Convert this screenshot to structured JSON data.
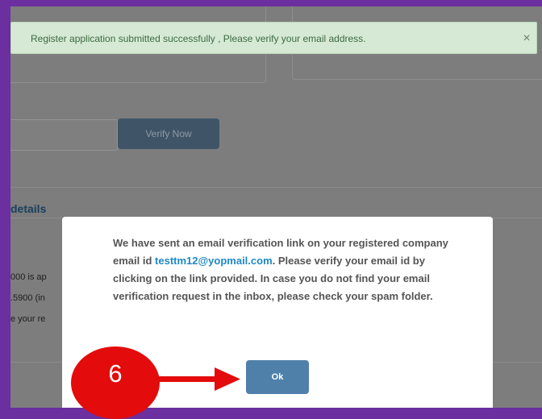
{
  "alert": {
    "message": "Register application submitted successfully , Please verify your email address.",
    "close_symbol": "×"
  },
  "background": {
    "verify_button_label": "Verify Now",
    "section_heading": "details",
    "fragments": [
      "000 is ap",
      ".5900 (in",
      "e your re"
    ]
  },
  "modal": {
    "text_before": "We have sent an email verification link on your registered company email id ",
    "email": "testtm12@yopmail.com",
    "text_after": ". Please verify your email id by clicking on the link provided. In case you do not find your email verification request in the inbox, please check your spam folder.",
    "ok_label": "Ok"
  },
  "annotation": {
    "step_number": "6",
    "color": "#e30b0b"
  },
  "colors": {
    "frame": "#6b2fa0",
    "overlay": "#7d7d7d",
    "ok_button": "#4e80aa",
    "email_link": "#1e88c8"
  }
}
